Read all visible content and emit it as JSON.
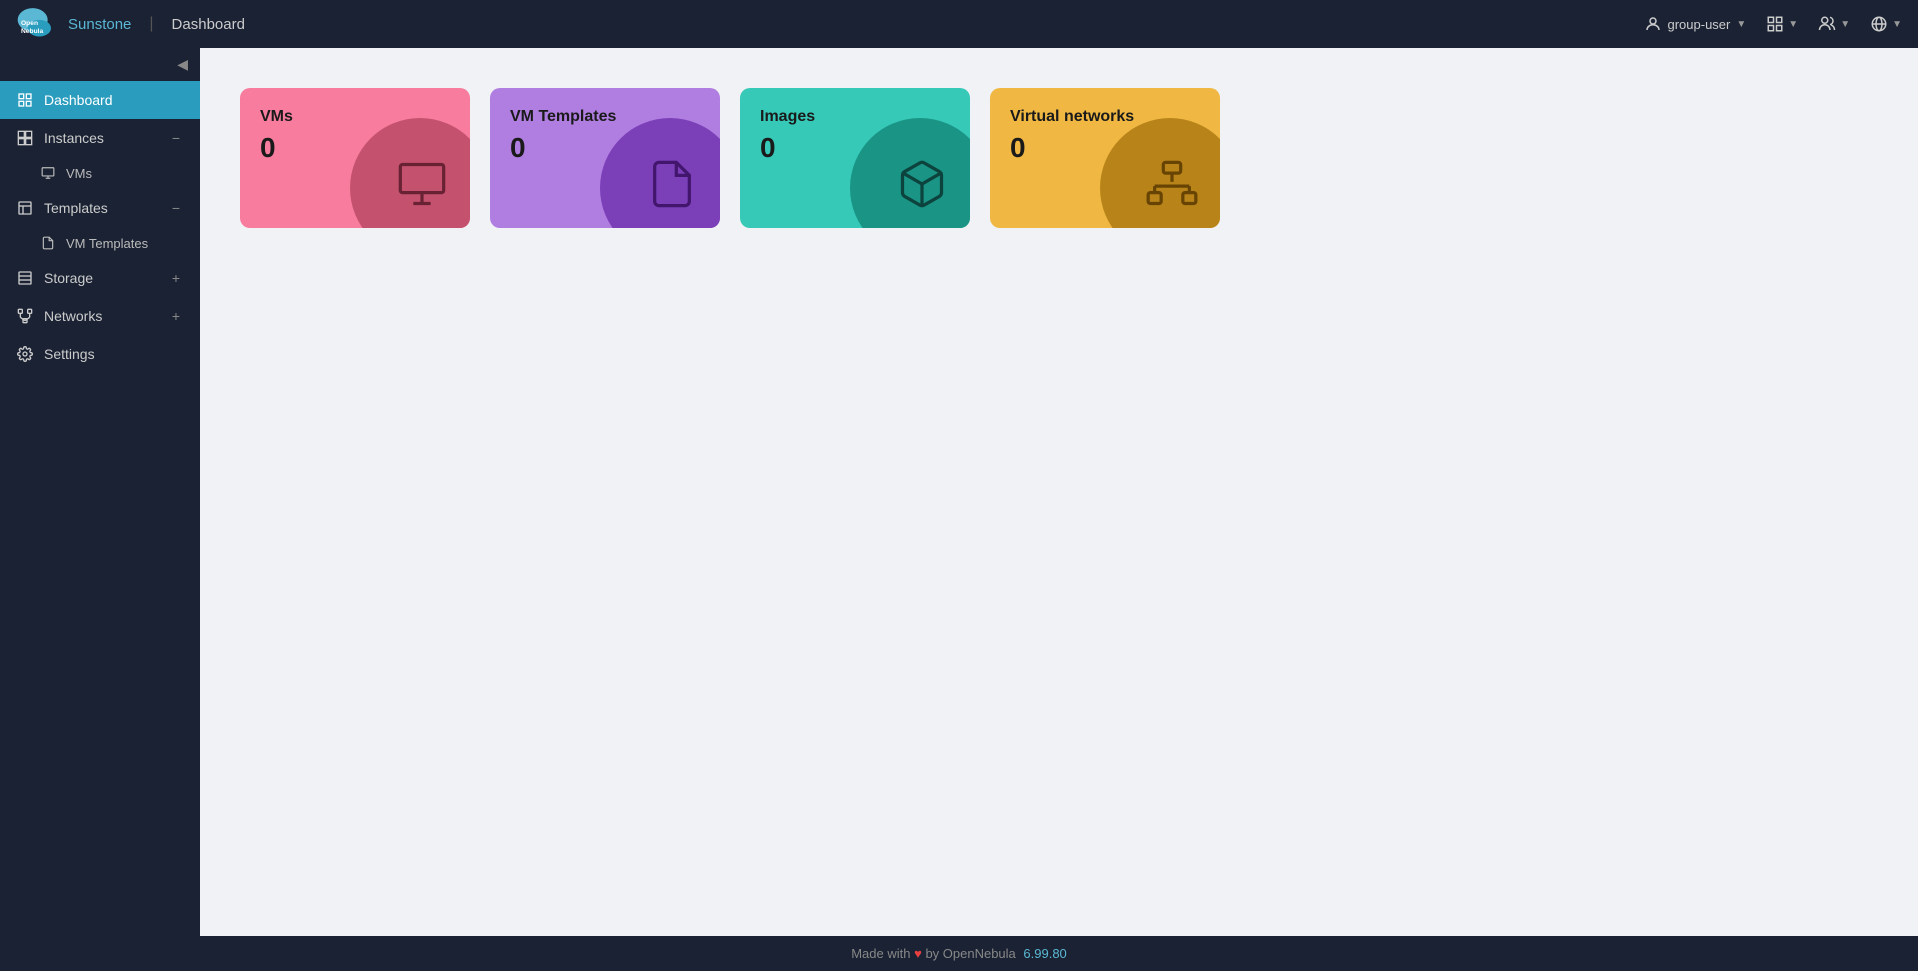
{
  "topbar": {
    "app_name": "Sunstone",
    "separator": "|",
    "page_title": "Dashboard",
    "user_label": "group-user",
    "collapse_icon": "◀",
    "grid_icon": "⊞",
    "users_icon": "👥",
    "globe_icon": "🌐"
  },
  "sidebar": {
    "collapse_label": "◀",
    "items": [
      {
        "id": "dashboard",
        "label": "Dashboard",
        "active": true
      },
      {
        "id": "instances",
        "label": "Instances",
        "expandable": true,
        "expanded": true,
        "toggle": "−"
      },
      {
        "id": "vms",
        "label": "VMs",
        "sub": true
      },
      {
        "id": "templates",
        "label": "Templates",
        "expandable": true,
        "expanded": true,
        "toggle": "−"
      },
      {
        "id": "vm-templates",
        "label": "VM Templates",
        "sub": true
      },
      {
        "id": "storage",
        "label": "Storage",
        "expandable": true,
        "expanded": false,
        "toggle": "+"
      },
      {
        "id": "networks",
        "label": "Networks",
        "expandable": true,
        "expanded": false,
        "toggle": "+"
      },
      {
        "id": "settings",
        "label": "Settings"
      }
    ]
  },
  "dashboard": {
    "cards": [
      {
        "id": "vms",
        "label": "VMs",
        "count": "0",
        "color_class": "card-vms"
      },
      {
        "id": "vmtemplates",
        "label": "VM Templates",
        "count": "0",
        "color_class": "card-vmtemplates"
      },
      {
        "id": "images",
        "label": "Images",
        "count": "0",
        "color_class": "card-images"
      },
      {
        "id": "vnet",
        "label": "Virtual networks",
        "count": "0",
        "color_class": "card-vnet"
      }
    ]
  },
  "footer": {
    "made_with": "Made with",
    "heart": "♥",
    "by_text": "by OpenNebula",
    "version": "6.99.80"
  }
}
